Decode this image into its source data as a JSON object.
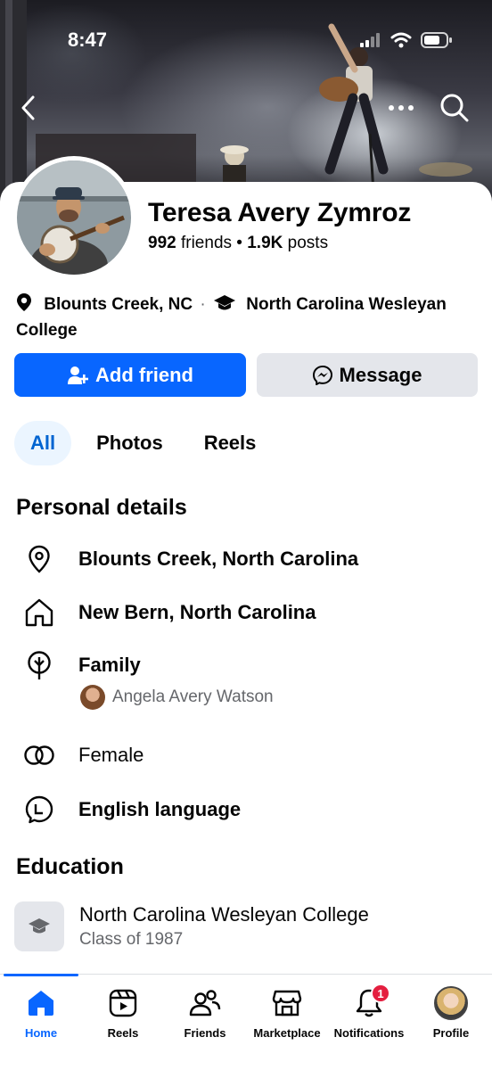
{
  "status_bar": {
    "time": "8:47"
  },
  "profile": {
    "name": "Teresa Avery Zymroz",
    "friends_count": "992",
    "friends_label": "friends",
    "posts_count": "1.9K",
    "posts_label": "posts",
    "location_short": "Blounts Creek, NC",
    "school_short": "North Carolina Wesleyan College"
  },
  "actions": {
    "add_friend": "Add friend",
    "message": "Message"
  },
  "tabs": [
    {
      "label": "All",
      "active": true
    },
    {
      "label": "Photos"
    },
    {
      "label": "Reels"
    }
  ],
  "personal_details": {
    "title": "Personal details",
    "current_city": "Blounts Creek, North Carolina",
    "hometown": "New Bern, North Carolina",
    "family_label": "Family",
    "family_member": "Angela Avery Watson",
    "gender": "Female",
    "language": "English language"
  },
  "education": {
    "title": "Education",
    "school": "North Carolina Wesleyan College",
    "class": "Class of 1987"
  },
  "bottom_nav": {
    "items": [
      {
        "label": "Home",
        "icon": "home-icon",
        "active": true
      },
      {
        "label": "Reels",
        "icon": "reels-icon"
      },
      {
        "label": "Friends",
        "icon": "friends-icon"
      },
      {
        "label": "Marketplace",
        "icon": "marketplace-icon"
      },
      {
        "label": "Notifications",
        "icon": "bell-icon",
        "badge": "1"
      },
      {
        "label": "Profile",
        "icon": "profile-avatar"
      }
    ]
  },
  "colors": {
    "accent": "#0866ff",
    "badge": "#e41e3f",
    "secondary_button": "#e4e6eb",
    "tab_active_bg": "#ebf5ff"
  }
}
